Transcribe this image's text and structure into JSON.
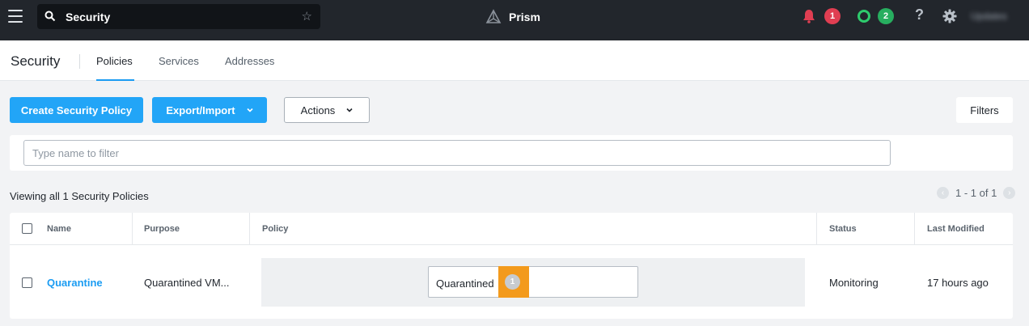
{
  "topbar": {
    "search_value": "Security",
    "brand": "Prism",
    "alerts_count": "1",
    "tasks_count": "2",
    "help": "?",
    "user": "Updates"
  },
  "subheader": {
    "title": "Security",
    "tabs": [
      {
        "label": "Policies",
        "active": true
      },
      {
        "label": "Services",
        "active": false
      },
      {
        "label": "Addresses",
        "active": false
      }
    ]
  },
  "toolbar": {
    "create_label": "Create Security Policy",
    "export_label": "Export/Import",
    "actions_label": "Actions",
    "filters_label": "Filters"
  },
  "filter": {
    "placeholder": "Type name to filter"
  },
  "summary": {
    "viewing": "Viewing all 1 Security Policies",
    "pagination": "1 - 1 of 1"
  },
  "table": {
    "headers": {
      "name": "Name",
      "purpose": "Purpose",
      "policy": "Policy",
      "status": "Status",
      "last_modified": "Last Modified"
    },
    "rows": [
      {
        "name": "Quarantine",
        "purpose": "Quarantined VM...",
        "policy_label": "Quarantined",
        "policy_count": "1",
        "status": "Monitoring",
        "last_modified": "17 hours ago"
      }
    ]
  },
  "colors": {
    "topbar_bg": "#22262c",
    "primary": "#22a5f7",
    "link": "#1b9cf2",
    "alert_red": "#e03e52",
    "task_green": "#27ae5f",
    "highlight_orange": "#f39a1c"
  }
}
